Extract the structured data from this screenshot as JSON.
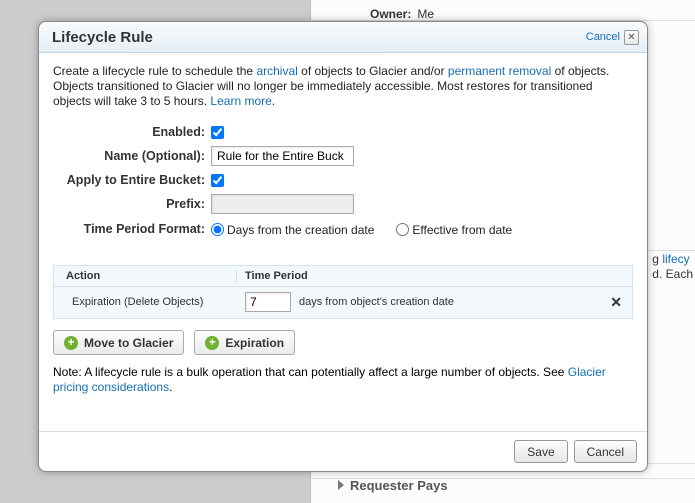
{
  "background": {
    "owner_label": "Owner:",
    "owner_value": "Me",
    "hint_part1": "g ",
    "hint_link": "lifecy",
    "hint_part2": "d. Each",
    "requester": "Requester Pays"
  },
  "dialog": {
    "title": "Lifecycle Rule",
    "cancel_link": "Cancel",
    "close_glyph": "✕",
    "intro": {
      "t1": "Create a lifecycle rule to schedule the ",
      "l1": "archival",
      "t2": " of objects to Glacier and/or ",
      "l2": "permanent removal",
      "t3": " of objects. Objects transitioned to Glacier will no longer be immediately accessible. Most restores for transitioned objects will take 3 to 5 hours. ",
      "l3": "Learn more",
      "t4": "."
    },
    "form": {
      "enabled_label": "Enabled:",
      "enabled_checked": true,
      "name_label": "Name (Optional):",
      "name_value": "Rule for the Entire Buck",
      "apply_label": "Apply to Entire Bucket:",
      "apply_checked": true,
      "prefix_label": "Prefix:",
      "prefix_value": "",
      "time_label": "Time Period Format:",
      "radio1": "Days from the creation date",
      "radio2": "Effective from date"
    },
    "rules": {
      "col_action": "Action",
      "col_time": "Time Period",
      "row": {
        "action": "Expiration (Delete Objects)",
        "days_value": "7",
        "suffix": "days from object's creation date",
        "remove": "✕"
      }
    },
    "buttons": {
      "move": "Move to Glacier",
      "exp": "Expiration"
    },
    "note": {
      "t1": "Note: A lifecycle rule is a bulk operation that can potentially affect a large number of objects. See ",
      "l1": "Glacier pricing considerations",
      "t2": "."
    },
    "footer": {
      "save": "Save",
      "cancel": "Cancel"
    }
  }
}
